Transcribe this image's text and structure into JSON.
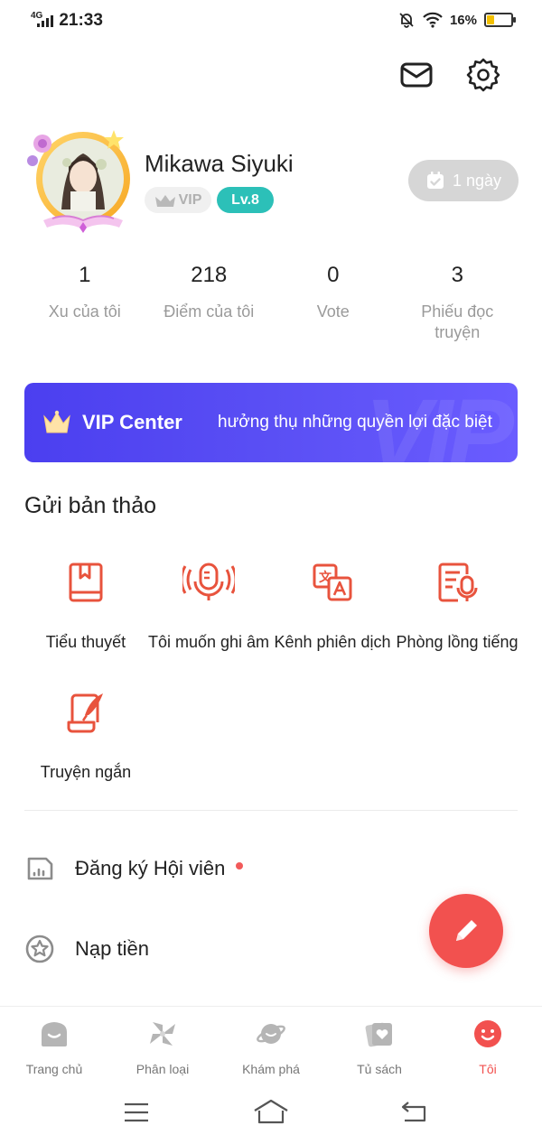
{
  "status_bar": {
    "network": "4G",
    "time": "21:33",
    "battery": "16%",
    "battery_level": 0.16
  },
  "header": {
    "mail_icon": "mail-icon",
    "settings_icon": "gear-icon"
  },
  "profile": {
    "username": "Mikawa Siyuki",
    "vip_badge": "VIP",
    "level_badge": "Lv.8",
    "checkin_label": "1 ngày"
  },
  "stats": [
    {
      "value": "1",
      "label": "Xu của tôi"
    },
    {
      "value": "218",
      "label": "Điểm của tôi"
    },
    {
      "value": "0",
      "label": "Vote"
    },
    {
      "value": "3",
      "label": "Phiếu đọc truyện"
    }
  ],
  "vip_banner": {
    "title": "VIP Center",
    "description": "hưởng thụ những quyền lợi đặc biệt",
    "watermark": "VIP"
  },
  "submit_section": {
    "title": "Gửi bản thảo",
    "items": [
      {
        "label": "Tiểu thuyết",
        "icon": "book-icon"
      },
      {
        "label": "Tôi muốn ghi âm",
        "icon": "microphone-icon"
      },
      {
        "label": "Kênh phiên dịch",
        "icon": "translate-icon"
      },
      {
        "label": "Phòng lồng tiếng",
        "icon": "dubbing-icon"
      },
      {
        "label": "Truyện ngắn",
        "icon": "quill-scroll-icon"
      }
    ]
  },
  "menu": {
    "items": [
      {
        "label": "Đăng ký Hội viên",
        "icon": "membership-card-icon",
        "has_dot": true
      },
      {
        "label": "Nạp tiền",
        "icon": "star-coin-icon",
        "has_dot": false
      }
    ]
  },
  "fab": {
    "icon": "pencil-icon"
  },
  "bottom_nav": {
    "items": [
      {
        "label": "Trang chủ",
        "icon": "home-icon",
        "active": false
      },
      {
        "label": "Phân loại",
        "icon": "category-pinwheel-icon",
        "active": false
      },
      {
        "label": "Khám phá",
        "icon": "planet-icon",
        "active": false
      },
      {
        "label": "Tủ sách",
        "icon": "bookshelf-icon",
        "active": false
      },
      {
        "label": "Tôi",
        "icon": "smiley-profile-icon",
        "active": true
      }
    ]
  },
  "colors": {
    "accent": "#f2514f",
    "vip_gradient_start": "#4b3ff0",
    "vip_gradient_end": "#6a5cff",
    "level_badge": "#2cc0b8",
    "icon_red": "#e8533d"
  }
}
